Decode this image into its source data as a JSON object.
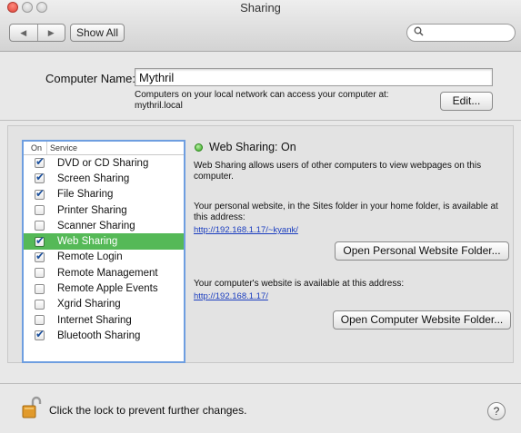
{
  "window": {
    "title": "Sharing",
    "controls": [
      "close",
      "minimize",
      "zoom"
    ]
  },
  "toolbar": {
    "back_icon": "◀",
    "forward_icon": "▶",
    "show_all_label": "Show All",
    "search_placeholder": "",
    "search_icon": "search-icon"
  },
  "computer_name": {
    "label": "Computer Name:",
    "value": "Mythril",
    "note_line1": "Computers on your local network can access your computer at:",
    "note_line2": "mythril.local",
    "edit_label": "Edit..."
  },
  "services": {
    "header_on": "On",
    "header_service": "Service",
    "items": [
      {
        "label": "DVD or CD Sharing",
        "on": true,
        "selected": false
      },
      {
        "label": "Screen Sharing",
        "on": true,
        "selected": false
      },
      {
        "label": "File Sharing",
        "on": true,
        "selected": false
      },
      {
        "label": "Printer Sharing",
        "on": false,
        "selected": false
      },
      {
        "label": "Scanner Sharing",
        "on": false,
        "selected": false
      },
      {
        "label": "Web Sharing",
        "on": true,
        "selected": true
      },
      {
        "label": "Remote Login",
        "on": true,
        "selected": false
      },
      {
        "label": "Remote Management",
        "on": false,
        "selected": false
      },
      {
        "label": "Remote Apple Events",
        "on": false,
        "selected": false
      },
      {
        "label": "Xgrid Sharing",
        "on": false,
        "selected": false
      },
      {
        "label": "Internet Sharing",
        "on": false,
        "selected": false
      },
      {
        "label": "Bluetooth Sharing",
        "on": true,
        "selected": false
      }
    ]
  },
  "detail": {
    "status": "Web Sharing: On",
    "status_color": "#2fa21a",
    "description": "Web Sharing allows users of other computers to view webpages on this computer.",
    "personal_text": "Your personal website, in the Sites folder in your home folder, is available at this address:",
    "personal_url": "http://192.168.1.17/~kyank/",
    "open_personal_label": "Open Personal Website Folder...",
    "computer_text": "Your computer's website is available at this address:",
    "computer_url": "http://192.168.1.17/",
    "open_computer_label": "Open Computer Website Folder..."
  },
  "footer": {
    "lock_text": "Click the lock to prevent further changes.",
    "help_label": "?"
  },
  "colors": {
    "selection": "#55b957",
    "list_focus_border": "#6e9ee0",
    "link": "#1a3dbf"
  }
}
